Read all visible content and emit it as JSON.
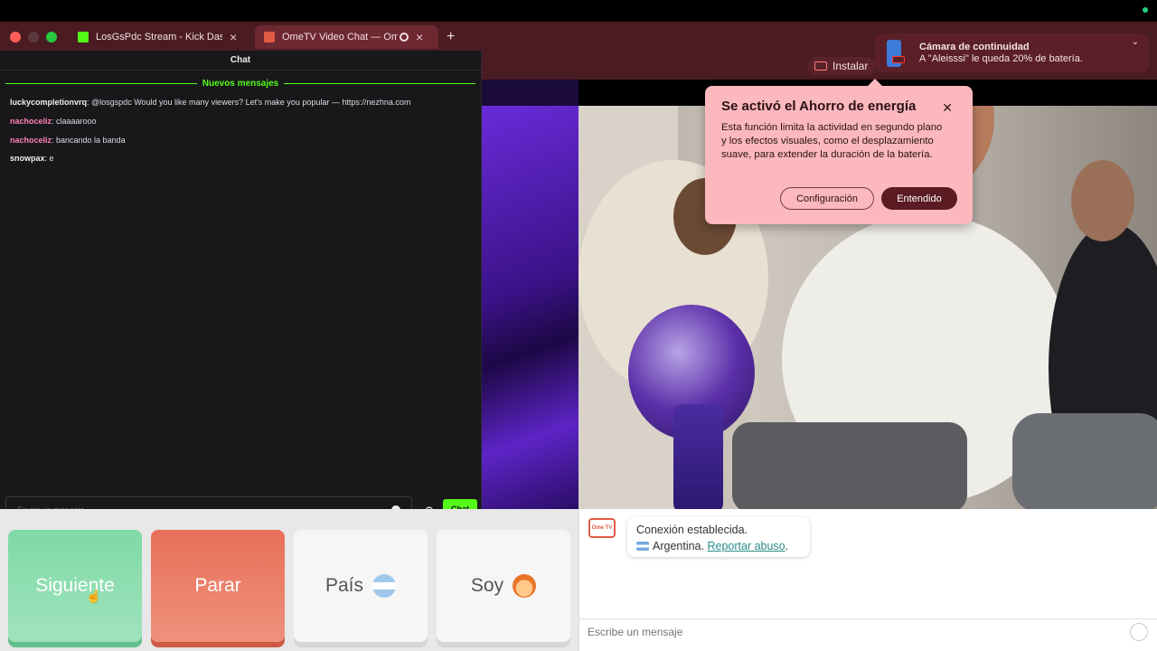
{
  "browser": {
    "tabs": [
      {
        "label": "LosGsPdc Stream - Kick Dash",
        "active": false
      },
      {
        "label": "OmeTV Video Chat — Ome",
        "active": true
      }
    ],
    "install_label": "Instalar"
  },
  "kick_chat": {
    "header": "Chat",
    "new_messages_label": "Nuevos mensajes",
    "messages": [
      {
        "user": "luckycompletionvrq",
        "user_color": "#efeff1",
        "text": ": @losgspdc Would you like many viewers? Let's make you popular — https://nezhna.com"
      },
      {
        "user": "nachoceliz",
        "user_color": "#ff7fb6",
        "text": ": claaaarooo"
      },
      {
        "user": "nachoceliz",
        "user_color": "#ff7fb6",
        "text": ": bancando la banda"
      },
      {
        "user": "snowpax",
        "user_color": "#efeff1",
        "text": ": e"
      }
    ],
    "input_placeholder": "Enviar un mensaje",
    "send_label": "Chat",
    "accent": "#53fc18"
  },
  "ometv": {
    "buttons": {
      "next": "Siguiente",
      "stop": "Parar",
      "country": "País",
      "me": "Soy"
    },
    "status_line1": "Conexión establecida.",
    "country_name": "Argentina.",
    "report_link": "Reportar abuso",
    "report_suffix": ".",
    "logo_text": "Ome TV",
    "message_placeholder": "Escribe un mensaje"
  },
  "energy_popup": {
    "title": "Se activó el Ahorro de energía",
    "body": "Esta función limita la actividad en segundo plano y los efectos visuales, como el desplazamiento suave, para extender la duración de la batería.",
    "config_label": "Configuración",
    "ok_label": "Entendido",
    "close_glyph": "✕"
  },
  "notification": {
    "title": "Cámara de continuidad",
    "body": "A \"Aleisssi\" le queda 20% de batería."
  }
}
